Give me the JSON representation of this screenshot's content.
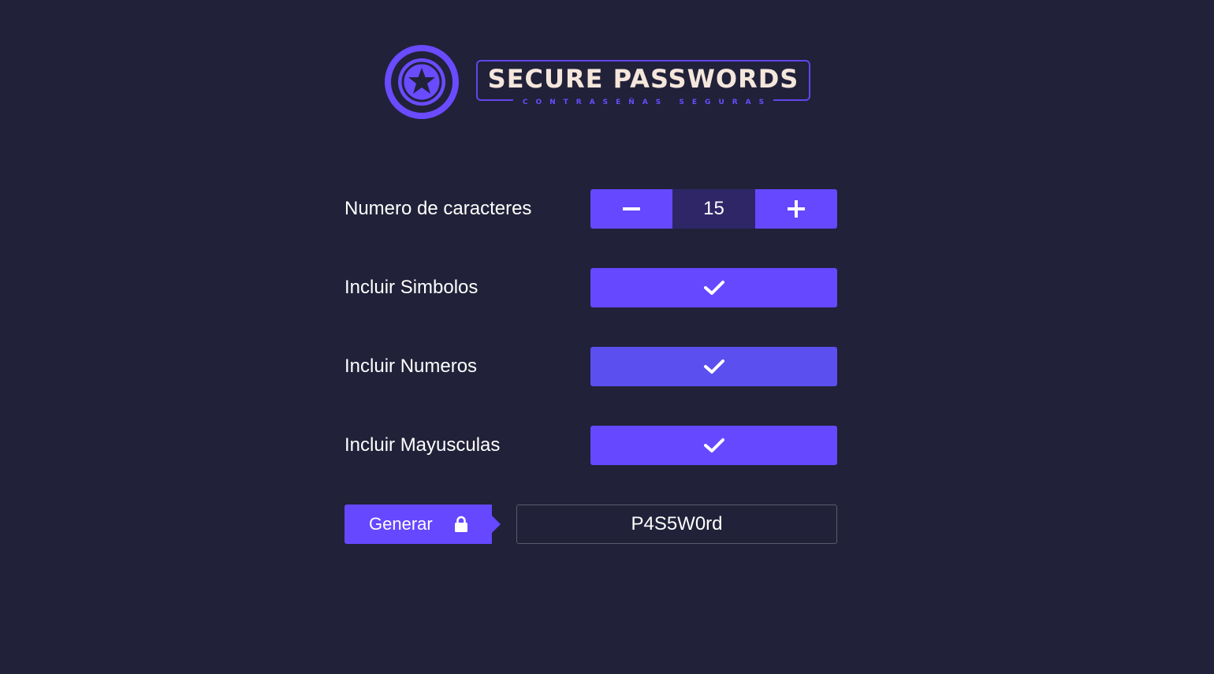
{
  "brand": {
    "title": "SECURE PASSWORDS",
    "subtitle": "CONTRASEÑAS SEGURAS",
    "icon": "shield-star-icon",
    "accent_color": "#6548ff",
    "background_color": "#212139"
  },
  "options": {
    "length": {
      "label": "Numero de caracteres",
      "value": "15",
      "decrement_icon": "minus-icon",
      "increment_icon": "plus-icon"
    },
    "symbols": {
      "label": "Incluir Simbolos",
      "checked": true,
      "icon": "check-icon"
    },
    "numbers": {
      "label": "Incluir Numeros",
      "checked": true,
      "icon": "check-icon"
    },
    "uppercase": {
      "label": "Incluir Mayusculas",
      "checked": true,
      "icon": "check-icon"
    }
  },
  "generate": {
    "label": "Generar",
    "icon": "lock-icon"
  },
  "output": {
    "password": "P4S5W0rd"
  }
}
